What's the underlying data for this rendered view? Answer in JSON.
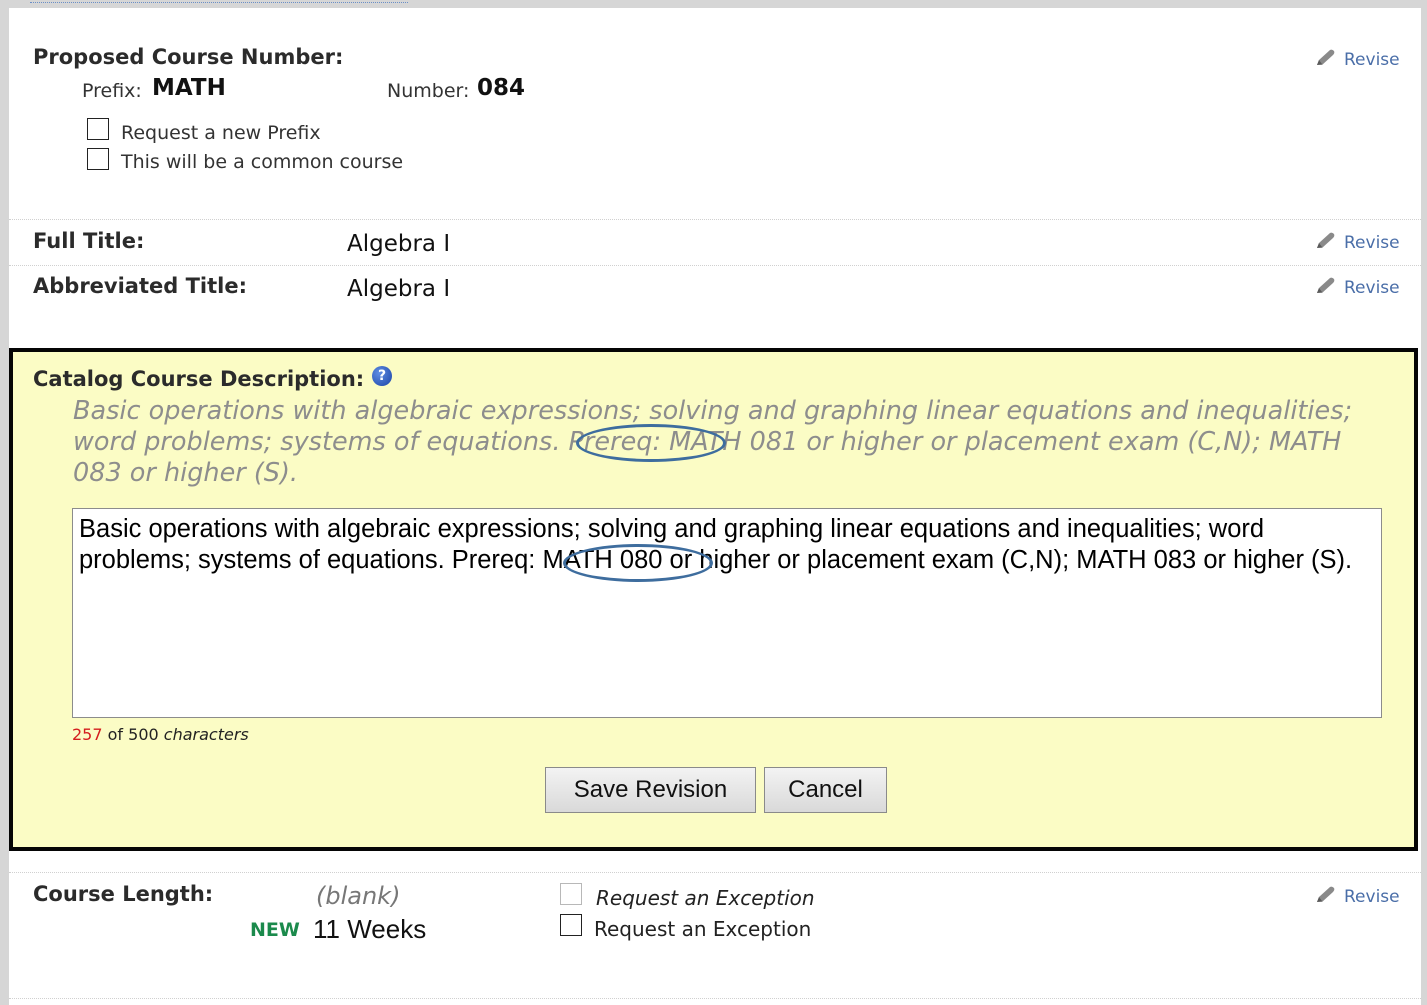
{
  "section_course_number": {
    "label": "Proposed Course Number:",
    "prefix_label": "Prefix:",
    "prefix_value": "MATH",
    "number_label": "Number:",
    "number_value": "084",
    "checkbox_new_prefix": "Request a new Prefix",
    "checkbox_common_course": "This will be a common course",
    "revise_label": "Revise"
  },
  "section_titles": {
    "full_title_label": "Full Title:",
    "full_title_value": "Algebra I",
    "abbreviated_title_label": "Abbreviated Title:",
    "abbreviated_title_value": "Algebra I",
    "revise_label": "Revise"
  },
  "section_description": {
    "label": "Catalog Course Description:",
    "help_icon": "question-icon",
    "original_text": "Basic operations with algebraic expressions; solving and graphing linear equations and inequalities; word problems; systems of equations. Prereq: MATH 081 or higher or placement exam (C,N); MATH 083 or higher (S).",
    "edited_text": "Basic operations with algebraic expressions; solving and graphing linear equations and inequalities; word problems; systems of equations. Prereq: MATH 080 or higher or placement exam (C,N); MATH 083 or higher (S).",
    "char_count": "257",
    "char_of": "of 500",
    "char_unit": "characters",
    "save_button": "Save Revision",
    "cancel_button": "Cancel"
  },
  "section_length": {
    "label": "Course Length:",
    "old_value": "(blank)",
    "new_tag": "NEW",
    "new_value": "11 Weeks",
    "exception_old": "Request an Exception",
    "exception_new": "Request an Exception",
    "revise_label": "Revise"
  },
  "colors": {
    "edit_panel_bg": "#fbfcc5",
    "link": "#4a6ea8",
    "new_tag": "#1b8a4c",
    "counter": "#d41d1d",
    "highlight_oval": "#3e6d9e"
  }
}
